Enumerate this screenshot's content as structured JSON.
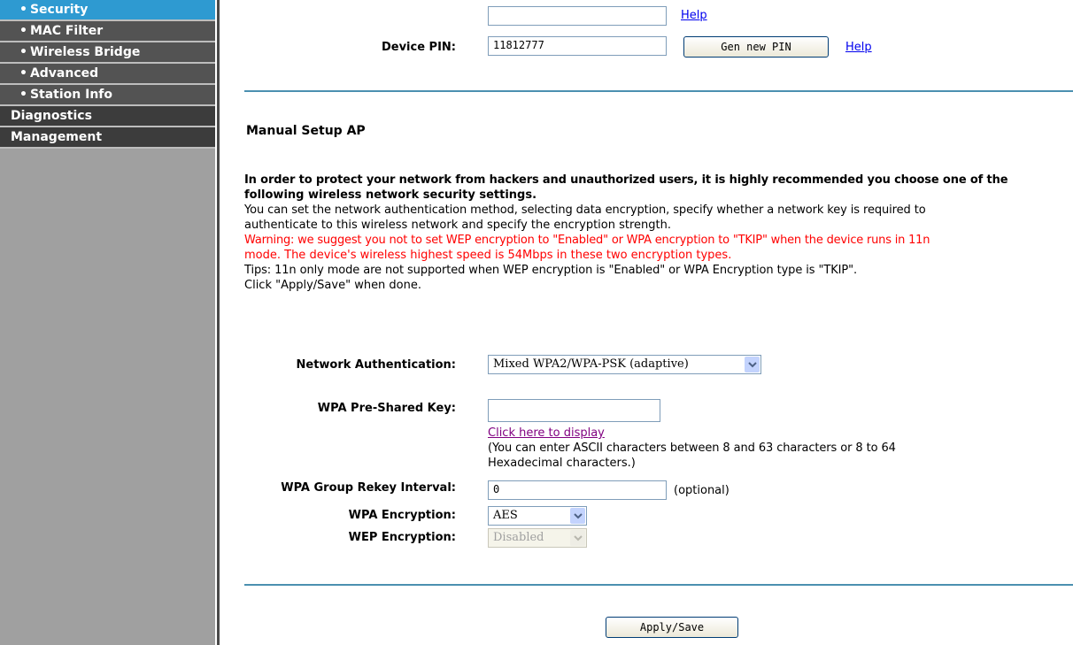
{
  "sidebar": {
    "items": [
      {
        "label": "Security",
        "bullet": "•"
      },
      {
        "label": "MAC Filter",
        "bullet": "•"
      },
      {
        "label": "Wireless Bridge",
        "bullet": "•"
      },
      {
        "label": "Advanced",
        "bullet": "•"
      },
      {
        "label": "Station Info",
        "bullet": "•"
      },
      {
        "label": "Diagnostics"
      },
      {
        "label": "Management"
      }
    ]
  },
  "wps": {
    "top_input_value": "",
    "help_1": "Help",
    "device_pin_label": "Device PIN:",
    "device_pin_value": "11812777",
    "gen_pin_button": "Gen new PIN",
    "help_2": "Help"
  },
  "manual": {
    "title": "Manual Setup AP",
    "intro_bold_1": "In order to protect your network from hackers and unauthorized users, it is highly recommended you choose one of the",
    "intro_bold_2": "following wireless network security settings.",
    "desc_1": "You can set the network authentication method, selecting data encryption, specify whether a network key is required to",
    "desc_2": "authenticate to this wireless network and specify the encryption strength.",
    "warning_1": "Warning: we suggest you not to set WEP encryption to \"Enabled\" or WPA encryption to \"TKIP\" when the device runs in 11n",
    "warning_2": "mode. The device's wireless highest speed is 54Mbps in these two encryption types.",
    "tips": "Tips: 11n only mode are not supported when WEP encryption is \"Enabled\" or WPA Encryption type is \"TKIP\".",
    "click_apply": "Click \"Apply/Save\" when done."
  },
  "form": {
    "net_auth_label": "Network Authentication:",
    "net_auth_value": "Mixed WPA2/WPA-PSK (adaptive)",
    "psk_label": "WPA Pre-Shared Key:",
    "psk_value": "",
    "display_link": "Click here to display",
    "psk_hint_1": "(You can enter ASCII characters between 8 and 63 characters or 8 to 64",
    "psk_hint_2": "Hexadecimal characters.)",
    "rekey_label": "WPA Group Rekey Interval:",
    "rekey_value": "0",
    "rekey_optional": "(optional)",
    "wpa_enc_label": "WPA Encryption:",
    "wpa_enc_value": "AES",
    "wep_enc_label": "WEP Encryption:",
    "wep_enc_value": "Disabled",
    "apply_button": "Apply/Save"
  },
  "icons": {
    "dropdown": "chevron-down-icon"
  },
  "colors": {
    "active_nav": "#2e9ad1",
    "nav": "#535353",
    "warning": "#ff0000",
    "divider": "#4b90b0"
  }
}
